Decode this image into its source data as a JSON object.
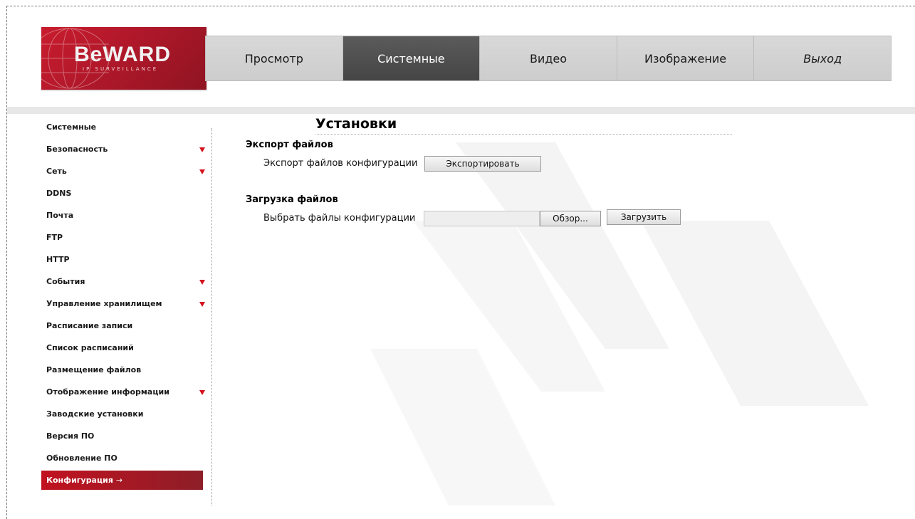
{
  "logo": {
    "brand": "BeWARD",
    "subtitle": "IP SURVEILLANCE"
  },
  "topnav": {
    "tabs": [
      {
        "label": "Просмотр",
        "active": false
      },
      {
        "label": "Системные",
        "active": true
      },
      {
        "label": "Видео",
        "active": false
      },
      {
        "label": "Изображение",
        "active": false
      },
      {
        "label": "Выход",
        "active": false
      }
    ]
  },
  "sidebar": {
    "items": [
      {
        "label": "Системные",
        "has_submenu": false
      },
      {
        "label": "Безопасность",
        "has_submenu": true
      },
      {
        "label": "Сеть",
        "has_submenu": true
      },
      {
        "label": "DDNS",
        "has_submenu": false
      },
      {
        "label": "Почта",
        "has_submenu": false
      },
      {
        "label": "FTP",
        "has_submenu": false
      },
      {
        "label": "HTTP",
        "has_submenu": false
      },
      {
        "label": "События",
        "has_submenu": true
      },
      {
        "label": "Управление хранилищем",
        "has_submenu": true
      },
      {
        "label": "Расписание записи",
        "has_submenu": false
      },
      {
        "label": "Список расписаний",
        "has_submenu": false
      },
      {
        "label": "Размещение файлов",
        "has_submenu": false
      },
      {
        "label": "Отображение информации",
        "has_submenu": true
      },
      {
        "label": "Заводские установки",
        "has_submenu": false
      },
      {
        "label": "Версия ПО",
        "has_submenu": false
      },
      {
        "label": "Обновление ПО",
        "has_submenu": false
      },
      {
        "label": "Конфигурация",
        "active": true
      }
    ],
    "active_arrow": "→"
  },
  "main": {
    "title": "Установки",
    "export": {
      "section_title": "Экспорт файлов",
      "row_label": "Экспорт файлов конфигурации",
      "button_label": "Экспортировать"
    },
    "upload": {
      "section_title": "Загрузка файлов",
      "row_label": "Выбрать файлы конфигурации",
      "file_value": "",
      "browse_label": "Обзор...",
      "upload_label": "Загрузить"
    }
  },
  "colors": {
    "accent_red": "#c1121f",
    "nav_active": "#4f4f4f",
    "nav_bg": "#d3d3d3"
  }
}
